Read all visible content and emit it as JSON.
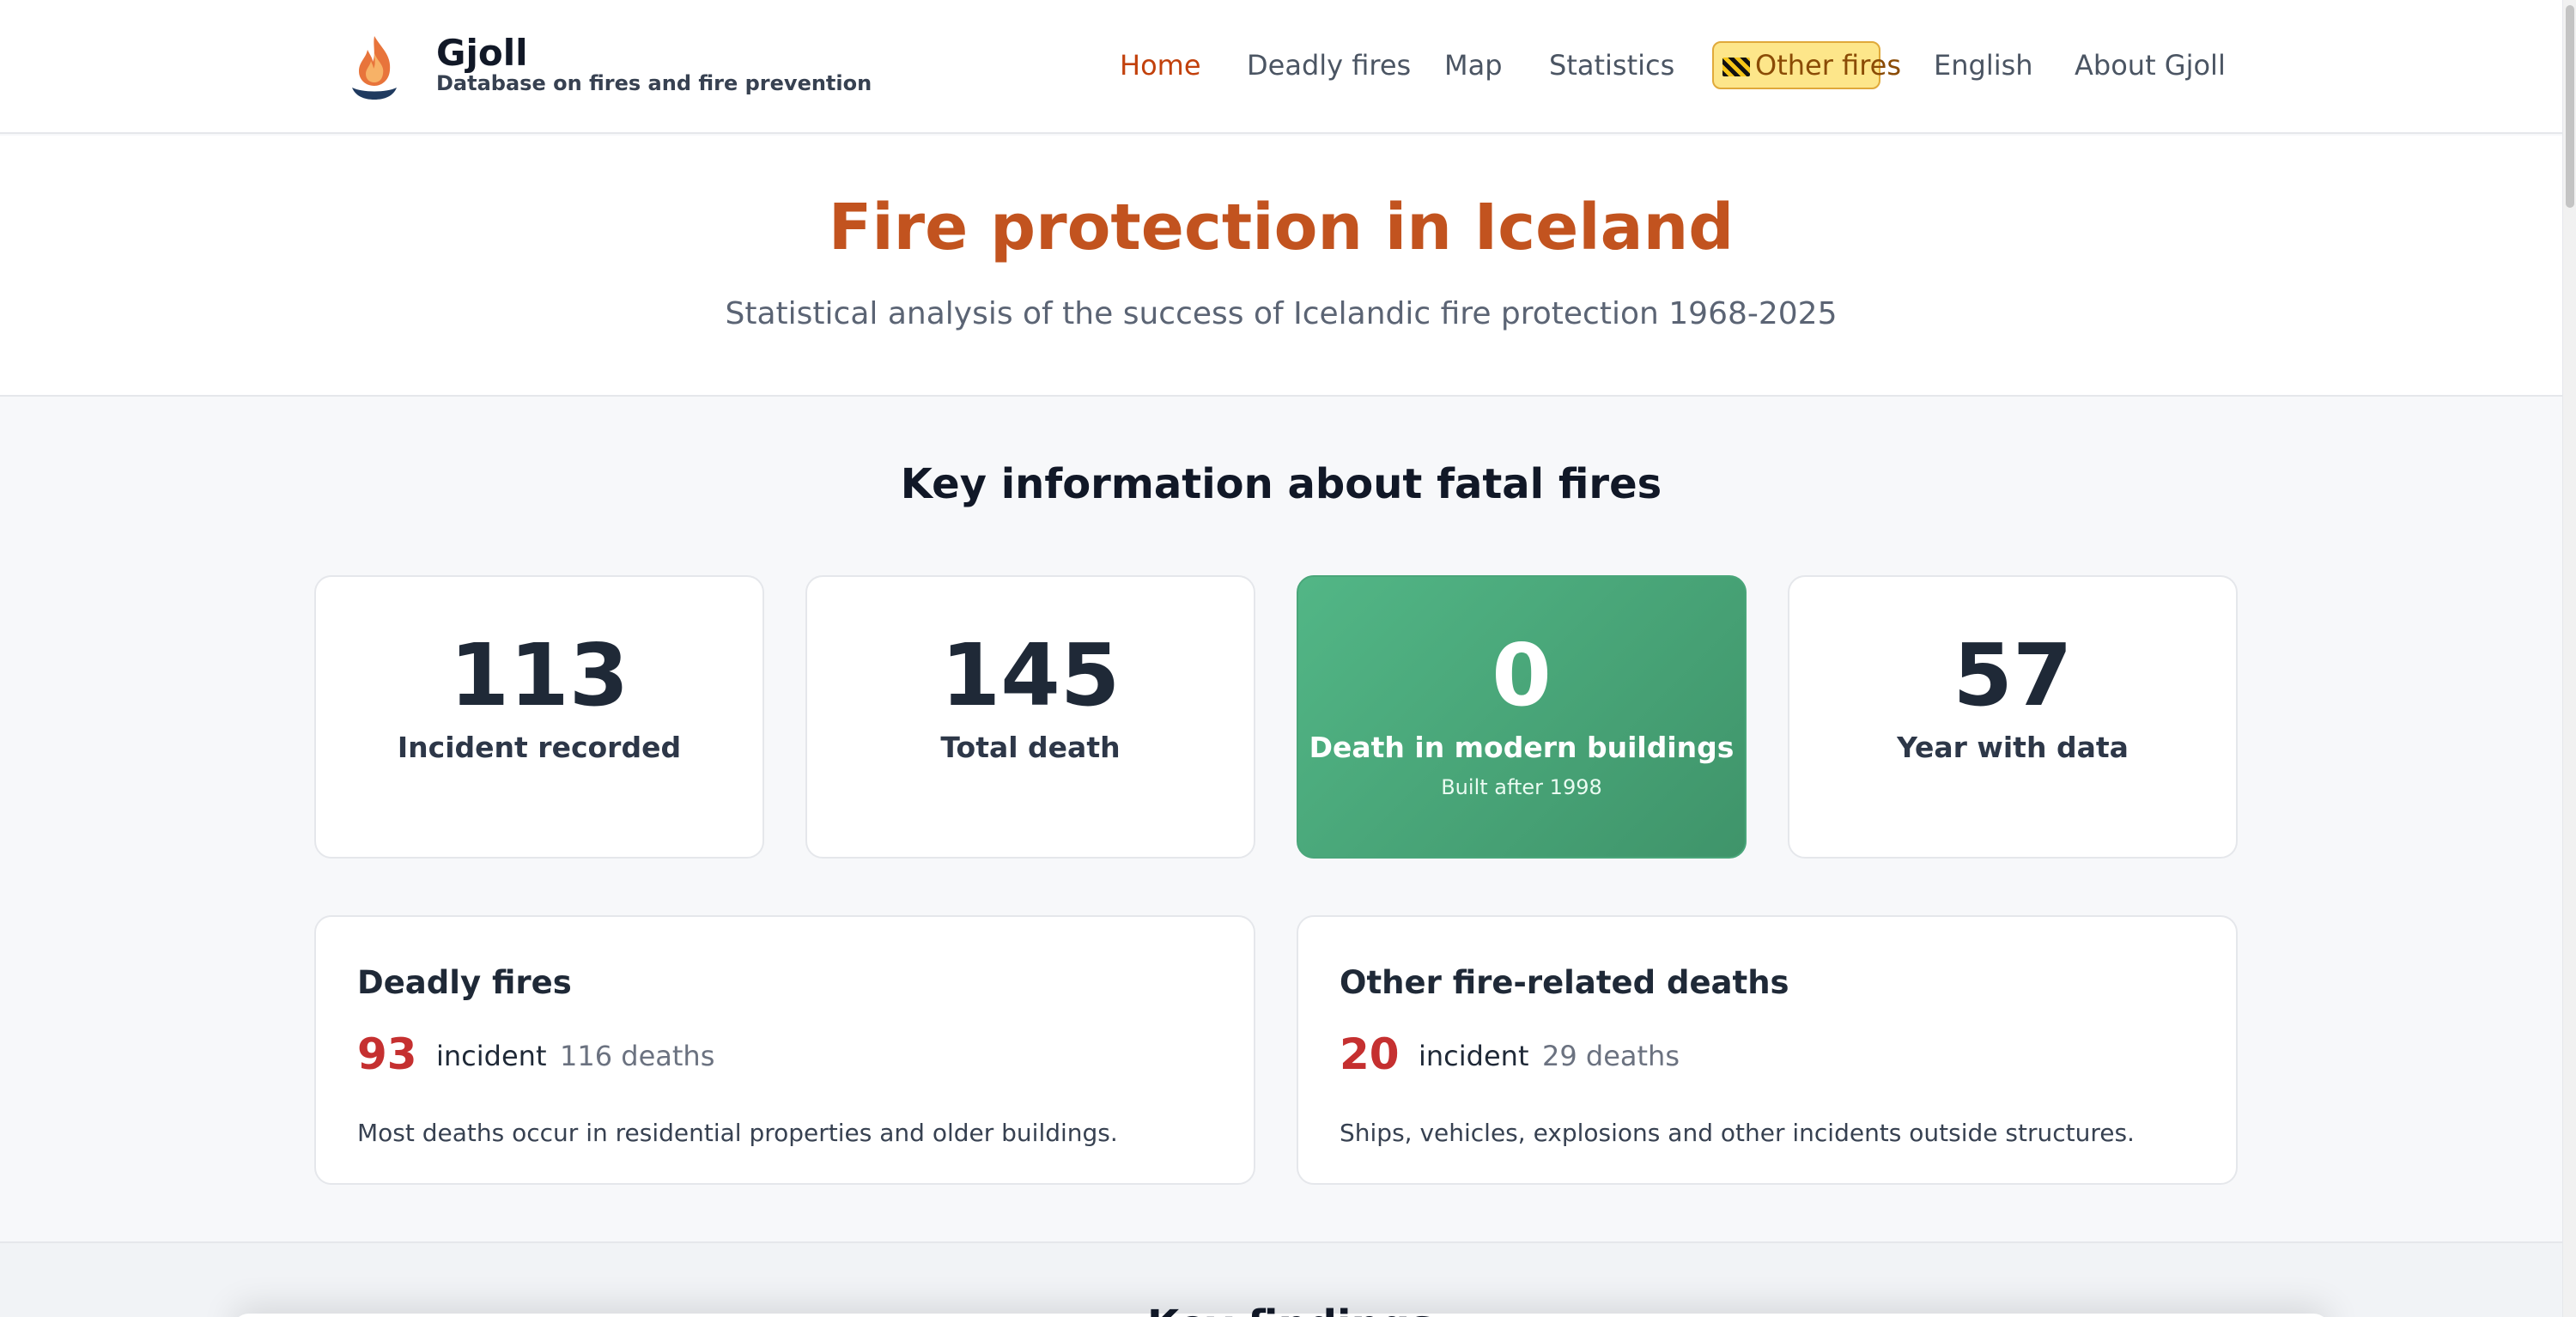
{
  "header": {
    "brand_name": "Gjoll",
    "brand_tagline": "Database on fires and fire prevention",
    "nav": {
      "home": "Home",
      "deadly_fires": "Deadly fires",
      "map": "Map",
      "statistics": "Statistics",
      "other_fires": "Other fires",
      "language": "English",
      "about": "About Gjoll"
    },
    "active_nav": "home"
  },
  "hero": {
    "title": "Fire protection in Iceland",
    "subtitle": "Statistical analysis of the success of Icelandic fire protection 1968-2025"
  },
  "key_info": {
    "title": "Key information about fatal fires",
    "stats": [
      {
        "value": "113",
        "label": "Incident recorded"
      },
      {
        "value": "145",
        "label": "Total death"
      },
      {
        "value": "0",
        "label": "Death in modern buildings",
        "note": "Built after 1998"
      },
      {
        "value": "57",
        "label": "Year with data"
      }
    ],
    "cards": [
      {
        "title": "Deadly fires",
        "count": "93",
        "unit": "incident",
        "deaths": "116 deaths",
        "description": "Most deaths occur in residential properties and older buildings."
      },
      {
        "title": "Other fire-related deaths",
        "count": "20",
        "unit": "incident",
        "deaths": "29 deaths",
        "description": "Ships, vehicles, explosions and other incidents outside structures."
      }
    ]
  },
  "next_section": {
    "title": "Key findings"
  },
  "colors": {
    "accent": "#c2531f",
    "active_nav": "#c2410c",
    "positive": "#4aa67a",
    "alert_number": "#c53030",
    "highlight_bg": "#fde68a"
  },
  "icons": {
    "logo": "flame-logo-icon",
    "other_fires": "construction-barrier-icon"
  }
}
